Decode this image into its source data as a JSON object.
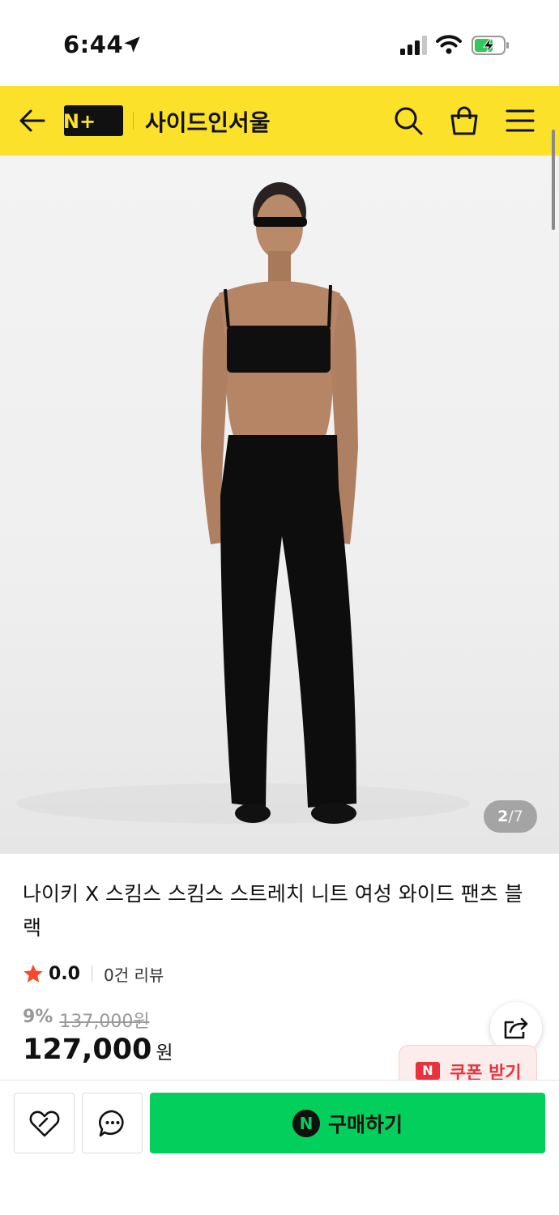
{
  "status_bar": {
    "time": "6:44"
  },
  "header": {
    "logo_text": "N+",
    "store_name": "사이드인서울"
  },
  "gallery": {
    "current": "2",
    "separator": "/",
    "total": "7"
  },
  "product": {
    "title": "나이키 X 스킴스 스킴스 스트레치 니트 여성 와이드 팬츠 블랙",
    "rating": "0.0",
    "review_count": "0건 리뷰",
    "discount": "9%",
    "original_price": "137,000원",
    "price": "127,000",
    "price_unit": "원"
  },
  "coupon": {
    "badge": "N",
    "label": "쿠폰 받기"
  },
  "bottom_bar": {
    "buy_badge": "N",
    "buy_label": "구매하기"
  },
  "colors": {
    "header_yellow": "#fbe12a",
    "buy_green": "#03cf5d",
    "accent_red": "#e8323c"
  }
}
